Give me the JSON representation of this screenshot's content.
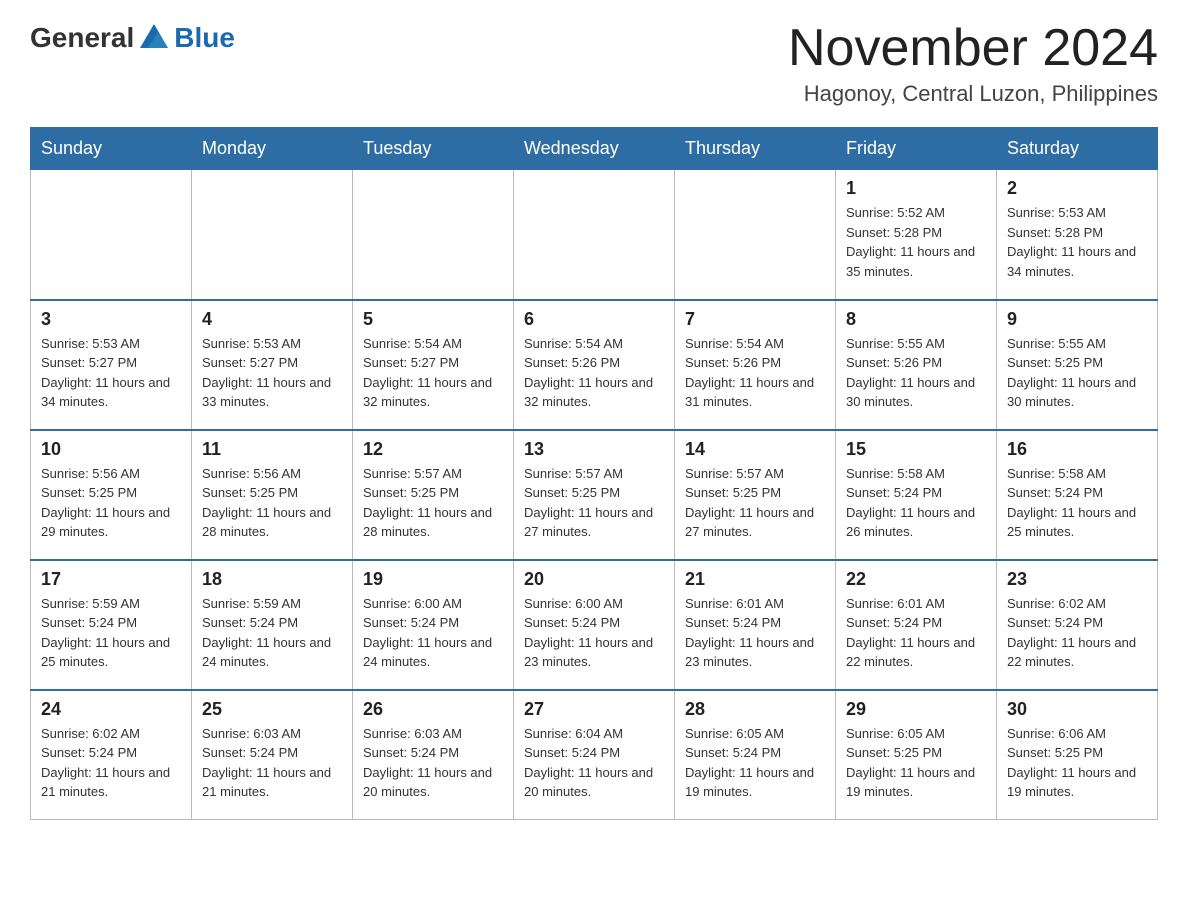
{
  "header": {
    "logo": {
      "general": "General",
      "blue": "Blue"
    },
    "title": "November 2024",
    "location": "Hagonoy, Central Luzon, Philippines"
  },
  "calendar": {
    "days_of_week": [
      "Sunday",
      "Monday",
      "Tuesday",
      "Wednesday",
      "Thursday",
      "Friday",
      "Saturday"
    ],
    "weeks": [
      [
        {
          "day": "",
          "info": ""
        },
        {
          "day": "",
          "info": ""
        },
        {
          "day": "",
          "info": ""
        },
        {
          "day": "",
          "info": ""
        },
        {
          "day": "",
          "info": ""
        },
        {
          "day": "1",
          "info": "Sunrise: 5:52 AM\nSunset: 5:28 PM\nDaylight: 11 hours and 35 minutes."
        },
        {
          "day": "2",
          "info": "Sunrise: 5:53 AM\nSunset: 5:28 PM\nDaylight: 11 hours and 34 minutes."
        }
      ],
      [
        {
          "day": "3",
          "info": "Sunrise: 5:53 AM\nSunset: 5:27 PM\nDaylight: 11 hours and 34 minutes."
        },
        {
          "day": "4",
          "info": "Sunrise: 5:53 AM\nSunset: 5:27 PM\nDaylight: 11 hours and 33 minutes."
        },
        {
          "day": "5",
          "info": "Sunrise: 5:54 AM\nSunset: 5:27 PM\nDaylight: 11 hours and 32 minutes."
        },
        {
          "day": "6",
          "info": "Sunrise: 5:54 AM\nSunset: 5:26 PM\nDaylight: 11 hours and 32 minutes."
        },
        {
          "day": "7",
          "info": "Sunrise: 5:54 AM\nSunset: 5:26 PM\nDaylight: 11 hours and 31 minutes."
        },
        {
          "day": "8",
          "info": "Sunrise: 5:55 AM\nSunset: 5:26 PM\nDaylight: 11 hours and 30 minutes."
        },
        {
          "day": "9",
          "info": "Sunrise: 5:55 AM\nSunset: 5:25 PM\nDaylight: 11 hours and 30 minutes."
        }
      ],
      [
        {
          "day": "10",
          "info": "Sunrise: 5:56 AM\nSunset: 5:25 PM\nDaylight: 11 hours and 29 minutes."
        },
        {
          "day": "11",
          "info": "Sunrise: 5:56 AM\nSunset: 5:25 PM\nDaylight: 11 hours and 28 minutes."
        },
        {
          "day": "12",
          "info": "Sunrise: 5:57 AM\nSunset: 5:25 PM\nDaylight: 11 hours and 28 minutes."
        },
        {
          "day": "13",
          "info": "Sunrise: 5:57 AM\nSunset: 5:25 PM\nDaylight: 11 hours and 27 minutes."
        },
        {
          "day": "14",
          "info": "Sunrise: 5:57 AM\nSunset: 5:25 PM\nDaylight: 11 hours and 27 minutes."
        },
        {
          "day": "15",
          "info": "Sunrise: 5:58 AM\nSunset: 5:24 PM\nDaylight: 11 hours and 26 minutes."
        },
        {
          "day": "16",
          "info": "Sunrise: 5:58 AM\nSunset: 5:24 PM\nDaylight: 11 hours and 25 minutes."
        }
      ],
      [
        {
          "day": "17",
          "info": "Sunrise: 5:59 AM\nSunset: 5:24 PM\nDaylight: 11 hours and 25 minutes."
        },
        {
          "day": "18",
          "info": "Sunrise: 5:59 AM\nSunset: 5:24 PM\nDaylight: 11 hours and 24 minutes."
        },
        {
          "day": "19",
          "info": "Sunrise: 6:00 AM\nSunset: 5:24 PM\nDaylight: 11 hours and 24 minutes."
        },
        {
          "day": "20",
          "info": "Sunrise: 6:00 AM\nSunset: 5:24 PM\nDaylight: 11 hours and 23 minutes."
        },
        {
          "day": "21",
          "info": "Sunrise: 6:01 AM\nSunset: 5:24 PM\nDaylight: 11 hours and 23 minutes."
        },
        {
          "day": "22",
          "info": "Sunrise: 6:01 AM\nSunset: 5:24 PM\nDaylight: 11 hours and 22 minutes."
        },
        {
          "day": "23",
          "info": "Sunrise: 6:02 AM\nSunset: 5:24 PM\nDaylight: 11 hours and 22 minutes."
        }
      ],
      [
        {
          "day": "24",
          "info": "Sunrise: 6:02 AM\nSunset: 5:24 PM\nDaylight: 11 hours and 21 minutes."
        },
        {
          "day": "25",
          "info": "Sunrise: 6:03 AM\nSunset: 5:24 PM\nDaylight: 11 hours and 21 minutes."
        },
        {
          "day": "26",
          "info": "Sunrise: 6:03 AM\nSunset: 5:24 PM\nDaylight: 11 hours and 20 minutes."
        },
        {
          "day": "27",
          "info": "Sunrise: 6:04 AM\nSunset: 5:24 PM\nDaylight: 11 hours and 20 minutes."
        },
        {
          "day": "28",
          "info": "Sunrise: 6:05 AM\nSunset: 5:24 PM\nDaylight: 11 hours and 19 minutes."
        },
        {
          "day": "29",
          "info": "Sunrise: 6:05 AM\nSunset: 5:25 PM\nDaylight: 11 hours and 19 minutes."
        },
        {
          "day": "30",
          "info": "Sunrise: 6:06 AM\nSunset: 5:25 PM\nDaylight: 11 hours and 19 minutes."
        }
      ]
    ]
  }
}
